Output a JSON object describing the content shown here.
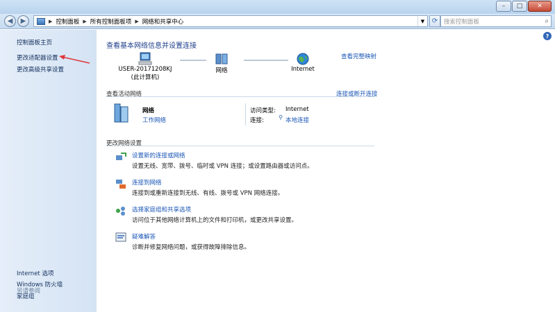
{
  "window": {
    "buttons": {
      "minimize": "–",
      "maximize": "□",
      "close": "✕"
    }
  },
  "addressbar": {
    "crumbs": [
      "控制面板",
      "所有控制面板项",
      "网络和共享中心"
    ],
    "search_placeholder": "搜索控制面板"
  },
  "sidebar": {
    "items": [
      "控制面板主页",
      "更改适配器设置",
      "更改高级共享设置"
    ],
    "see_also_title": "另请参阅",
    "see_also": [
      "Internet 选项",
      "Windows 防火墙",
      "家庭组"
    ]
  },
  "main": {
    "title": "查看基本网络信息并设置连接",
    "full_map": "查看完整映射",
    "nodes": {
      "computer": "USER-20171208KJ",
      "computer_sub": "(此计算机)",
      "network": "网络",
      "internet": "Internet"
    },
    "active": {
      "header": "查看活动网络",
      "connect_link": "连接或断开连接",
      "network_name": "网络",
      "network_type": "工作网络",
      "access_label": "访问类型:",
      "access_value": "Internet",
      "conn_label": "连接:",
      "conn_value": "本地连接"
    },
    "change": {
      "header": "更改网络设置",
      "tasks": [
        {
          "title": "设置新的连接或网络",
          "desc": "设置无线、宽带、拨号、临时或 VPN 连接；或设置路由器或访问点。"
        },
        {
          "title": "连接到网络",
          "desc": "连接到或重新连接到无线、有线、拨号或 VPN 网络连接。"
        },
        {
          "title": "选择家庭组和共享选项",
          "desc": "访问位于其他网络计算机上的文件和打印机，或更改共享设置。"
        },
        {
          "title": "疑难解答",
          "desc": "诊断并修复网络问题，或获得故障排除信息。"
        }
      ]
    }
  },
  "colors": {
    "link": "#1a56b6",
    "title": "#1e3f8a",
    "annotation_arrow": "#e0393d"
  }
}
